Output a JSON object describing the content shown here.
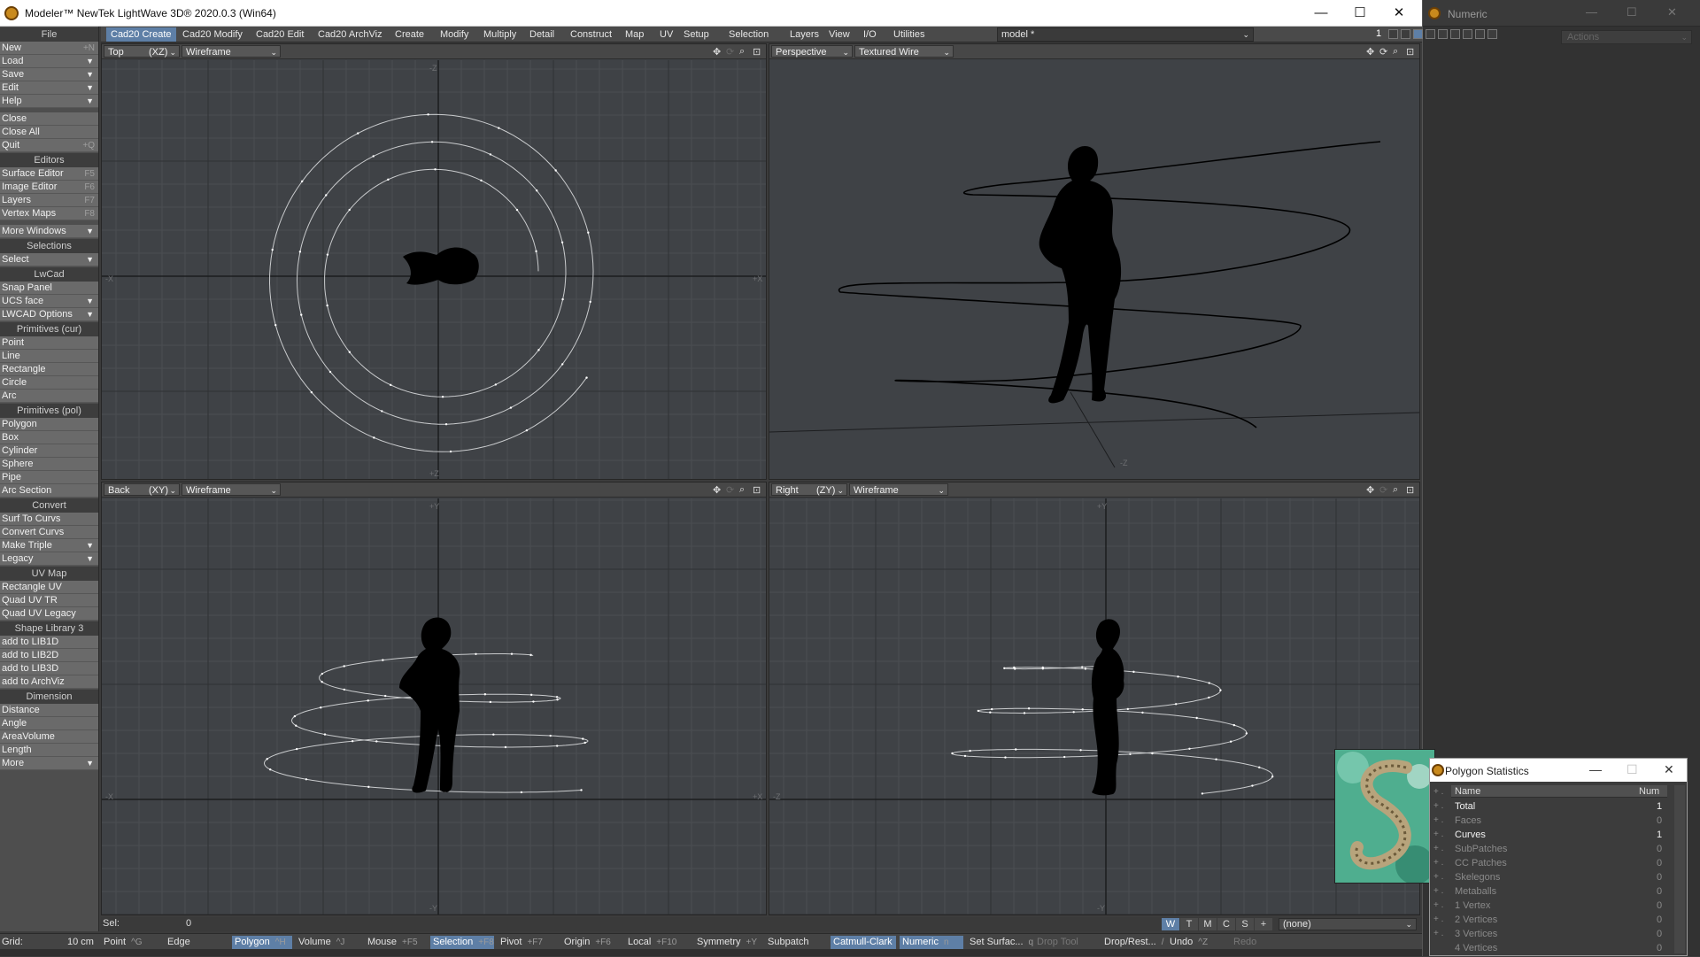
{
  "window": {
    "title": "Modeler™ NewTek LightWave 3D® 2020.0.3 (Win64)",
    "minimize": "—",
    "maximize": "☐",
    "close": "✕"
  },
  "numeric": {
    "title": "Numeric",
    "actions": "Actions"
  },
  "tabs": [
    "Cad20 Create",
    "Cad20 Modify",
    "Cad20 Edit",
    "Cad20 ArchViz",
    "Create",
    "Modify",
    "Multiply",
    "Detail",
    "Construct",
    "Map",
    "UV",
    "Setup",
    "Selection",
    "Layers",
    "View",
    "I/O",
    "Utilities"
  ],
  "model": "model *",
  "layer_number": "1",
  "sidebar": [
    {
      "type": "header",
      "label": "File"
    },
    {
      "type": "item",
      "label": "New",
      "sc": "+N"
    },
    {
      "type": "item",
      "label": "Load",
      "dd": true
    },
    {
      "type": "item",
      "label": "Save",
      "dd": true
    },
    {
      "type": "item",
      "label": "Edit",
      "dd": true
    },
    {
      "type": "item",
      "label": "Help",
      "dd": true
    },
    {
      "type": "gap"
    },
    {
      "type": "item",
      "label": "Close"
    },
    {
      "type": "item",
      "label": "Close All"
    },
    {
      "type": "item",
      "label": "Quit",
      "sc": "+Q"
    },
    {
      "type": "header",
      "label": "Editors"
    },
    {
      "type": "item",
      "label": "Surface Editor",
      "sc": "F5"
    },
    {
      "type": "item",
      "label": "Image Editor",
      "sc": "F6"
    },
    {
      "type": "item",
      "label": "Layers",
      "sc": "F7"
    },
    {
      "type": "item",
      "label": "Vertex Maps",
      "sc": "F8"
    },
    {
      "type": "gap"
    },
    {
      "type": "item",
      "label": "More Windows",
      "dd": true
    },
    {
      "type": "header",
      "label": "Selections"
    },
    {
      "type": "item",
      "label": "Select",
      "dd": true
    },
    {
      "type": "header",
      "label": "LwCad"
    },
    {
      "type": "item",
      "label": "Snap Panel"
    },
    {
      "type": "item",
      "label": "UCS face",
      "dd": true
    },
    {
      "type": "item",
      "label": "LWCAD Options",
      "dd": true
    },
    {
      "type": "header",
      "label": "Primitives (cur)"
    },
    {
      "type": "item",
      "label": "Point"
    },
    {
      "type": "item",
      "label": "Line"
    },
    {
      "type": "item",
      "label": "Rectangle"
    },
    {
      "type": "item",
      "label": "Circle"
    },
    {
      "type": "item",
      "label": "Arc"
    },
    {
      "type": "header",
      "label": "Primitives (pol)"
    },
    {
      "type": "item",
      "label": "Polygon"
    },
    {
      "type": "item",
      "label": "Box"
    },
    {
      "type": "item",
      "label": "Cylinder"
    },
    {
      "type": "item",
      "label": "Sphere"
    },
    {
      "type": "item",
      "label": "Pipe"
    },
    {
      "type": "item",
      "label": "Arc Section"
    },
    {
      "type": "header",
      "label": "Convert"
    },
    {
      "type": "item",
      "label": "Surf To Curvs"
    },
    {
      "type": "item",
      "label": "Convert Curvs"
    },
    {
      "type": "item",
      "label": "Make Triple",
      "dd": true
    },
    {
      "type": "item",
      "label": "Legacy",
      "dd": true
    },
    {
      "type": "header",
      "label": "UV Map"
    },
    {
      "type": "item",
      "label": "Rectangle UV"
    },
    {
      "type": "item",
      "label": "Quad UV TR"
    },
    {
      "type": "item",
      "label": "Quad UV Legacy"
    },
    {
      "type": "header",
      "label": "Shape Library 3"
    },
    {
      "type": "item",
      "label": "add to LIB1D"
    },
    {
      "type": "item",
      "label": "add to LIB2D"
    },
    {
      "type": "item",
      "label": "add to LIB3D"
    },
    {
      "type": "item",
      "label": "add to ArchViz"
    },
    {
      "type": "header",
      "label": "Dimension"
    },
    {
      "type": "item",
      "label": "Distance"
    },
    {
      "type": "item",
      "label": "Angle"
    },
    {
      "type": "item",
      "label": "AreaVolume"
    },
    {
      "type": "item",
      "label": "Length"
    },
    {
      "type": "item",
      "label": "More",
      "dd": true
    }
  ],
  "viewports": [
    {
      "view": "Top",
      "axis": "(XZ)",
      "mode": "Wireframe"
    },
    {
      "view": "Perspective",
      "axis": "",
      "mode": "Textured Wire"
    },
    {
      "view": "Back",
      "axis": "(XY)",
      "mode": "Wireframe"
    },
    {
      "view": "Right",
      "axis": "(ZY)",
      "mode": "Wireframe"
    }
  ],
  "axis_labels": {
    "minus_x": "-X",
    "plus_x": "+X",
    "minus_z": "-Z",
    "plus_z": "+Z",
    "minus_y": "-Y",
    "plus_y": "+Y",
    "persp_z": "-Z"
  },
  "sel": {
    "label": "Sel:",
    "value": "0"
  },
  "wtm": [
    "W",
    "T",
    "M",
    "C",
    "S",
    "+"
  ],
  "none_select": "(none)",
  "grid": {
    "label": "Grid:",
    "value": "10 cm"
  },
  "statusbar": [
    {
      "label": "Point",
      "key": "^G"
    },
    {
      "label": "Edge",
      "key": ""
    },
    {
      "label": "Polygon",
      "key": "^H",
      "on": true
    },
    {
      "label": "Volume",
      "key": "^J"
    },
    {
      "label": "Mouse",
      "key": "+F5"
    },
    {
      "label": "Selection",
      "key": "+F8",
      "on": true
    },
    {
      "label": "Pivot",
      "key": "+F7"
    },
    {
      "label": "Origin",
      "key": "+F6"
    },
    {
      "label": "Local",
      "key": "+F10"
    },
    {
      "label": "Symmetry",
      "key": "+Y"
    },
    {
      "label": "Subpatch",
      "key": ""
    },
    {
      "label": "Catmull-Clark",
      "key": "",
      "on": true
    },
    {
      "label": "Numeric",
      "key": "n",
      "on": true
    },
    {
      "label": "Set Surfac...",
      "key": "q"
    },
    {
      "label": "Drop Tool",
      "key": "",
      "dis": true
    },
    {
      "label": "Drop/Rest...",
      "key": "/"
    },
    {
      "label": "Undo",
      "key": "^Z"
    },
    {
      "label": "Redo",
      "key": "",
      "dis": true
    }
  ],
  "polystats": {
    "title": "Polygon Statistics",
    "col_name": "Name",
    "col_num": "Num",
    "rows": [
      {
        "name": "Total",
        "num": "1",
        "bold": true
      },
      {
        "name": "Faces",
        "num": "0"
      },
      {
        "name": "Curves",
        "num": "1",
        "bold": true
      },
      {
        "name": "SubPatches",
        "num": "0"
      },
      {
        "name": "CC Patches",
        "num": "0"
      },
      {
        "name": "Skelegons",
        "num": "0"
      },
      {
        "name": "Metaballs",
        "num": "0"
      },
      {
        "name": "1 Vertex",
        "num": "0"
      },
      {
        "name": "2 Vertices",
        "num": "0"
      },
      {
        "name": "3 Vertices",
        "num": "0"
      },
      {
        "name": "4 Vertices",
        "num": "0"
      }
    ]
  },
  "colors": {
    "accent": "#5e7fa6",
    "viewport_bg": "#3f4246",
    "panel": "#4e4e4e"
  }
}
